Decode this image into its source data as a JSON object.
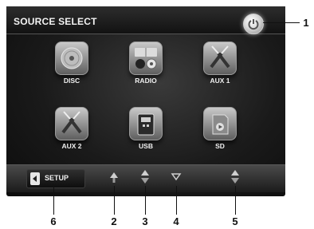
{
  "header": {
    "title": "SOURCE SELECT"
  },
  "sources": [
    {
      "label": "DISC",
      "icon": "disc-icon"
    },
    {
      "label": "RADIO",
      "icon": "radio-icon"
    },
    {
      "label": "AUX 1",
      "icon": "aux-cable-icon"
    },
    {
      "label": "AUX 2",
      "icon": "aux-cable-icon"
    },
    {
      "label": "USB",
      "icon": "usb-icon"
    },
    {
      "label": "SD",
      "icon": "sd-card-icon"
    }
  ],
  "bottom_bar": {
    "setup_label": "SETUP",
    "buttons": [
      "eject-up-icon",
      "up-down-icon",
      "down-icon",
      "up-down-icon"
    ]
  },
  "callouts": [
    "1",
    "2",
    "3",
    "4",
    "5",
    "6"
  ]
}
